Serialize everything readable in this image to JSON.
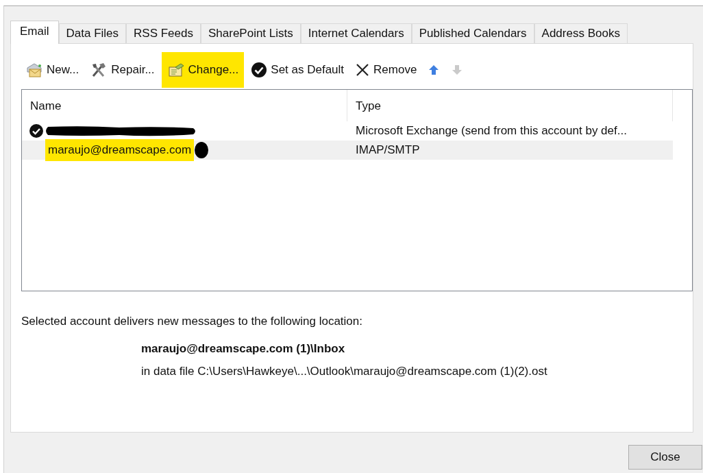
{
  "tabs": [
    {
      "label": "Email",
      "selected": true
    },
    {
      "label": "Data Files",
      "selected": false
    },
    {
      "label": "RSS Feeds",
      "selected": false
    },
    {
      "label": "SharePoint Lists",
      "selected": false
    },
    {
      "label": "Internet Calendars",
      "selected": false
    },
    {
      "label": "Published Calendars",
      "selected": false
    },
    {
      "label": "Address Books",
      "selected": false
    }
  ],
  "toolbar": [
    {
      "kind": "new",
      "label": "New...",
      "highlighted": false,
      "disabled": false
    },
    {
      "kind": "repair",
      "label": "Repair...",
      "highlighted": false,
      "disabled": false
    },
    {
      "kind": "change",
      "label": "Change...",
      "highlighted": true,
      "disabled": false
    },
    {
      "kind": "default",
      "label": "Set as Default",
      "highlighted": false,
      "disabled": false
    },
    {
      "kind": "remove",
      "label": "Remove",
      "highlighted": false,
      "disabled": false
    },
    {
      "kind": "up",
      "highlighted": false,
      "disabled": false
    },
    {
      "kind": "down",
      "highlighted": false,
      "disabled": true
    }
  ],
  "table": {
    "columns": [
      "Name",
      "Type"
    ],
    "rows": [
      {
        "default": true,
        "redacted": true,
        "selected": false,
        "type": "Microsoft Exchange (send from this account by def..."
      },
      {
        "default": false,
        "name": "maraujo@dreamscape.com",
        "redacted": true,
        "highlighted": true,
        "selected": true,
        "type": "IMAP/SMTP"
      }
    ]
  },
  "delivery": {
    "intro": "Selected account delivers new messages to the following location:",
    "folder": "maraujo@dreamscape.com (1)\\Inbox",
    "data_file": "in data file C:\\Users\\Hawkeye\\...\\Outlook\\maraujo@dreamscape.com (1)(2).ost"
  },
  "buttons": [
    {
      "label": "Close"
    }
  ]
}
